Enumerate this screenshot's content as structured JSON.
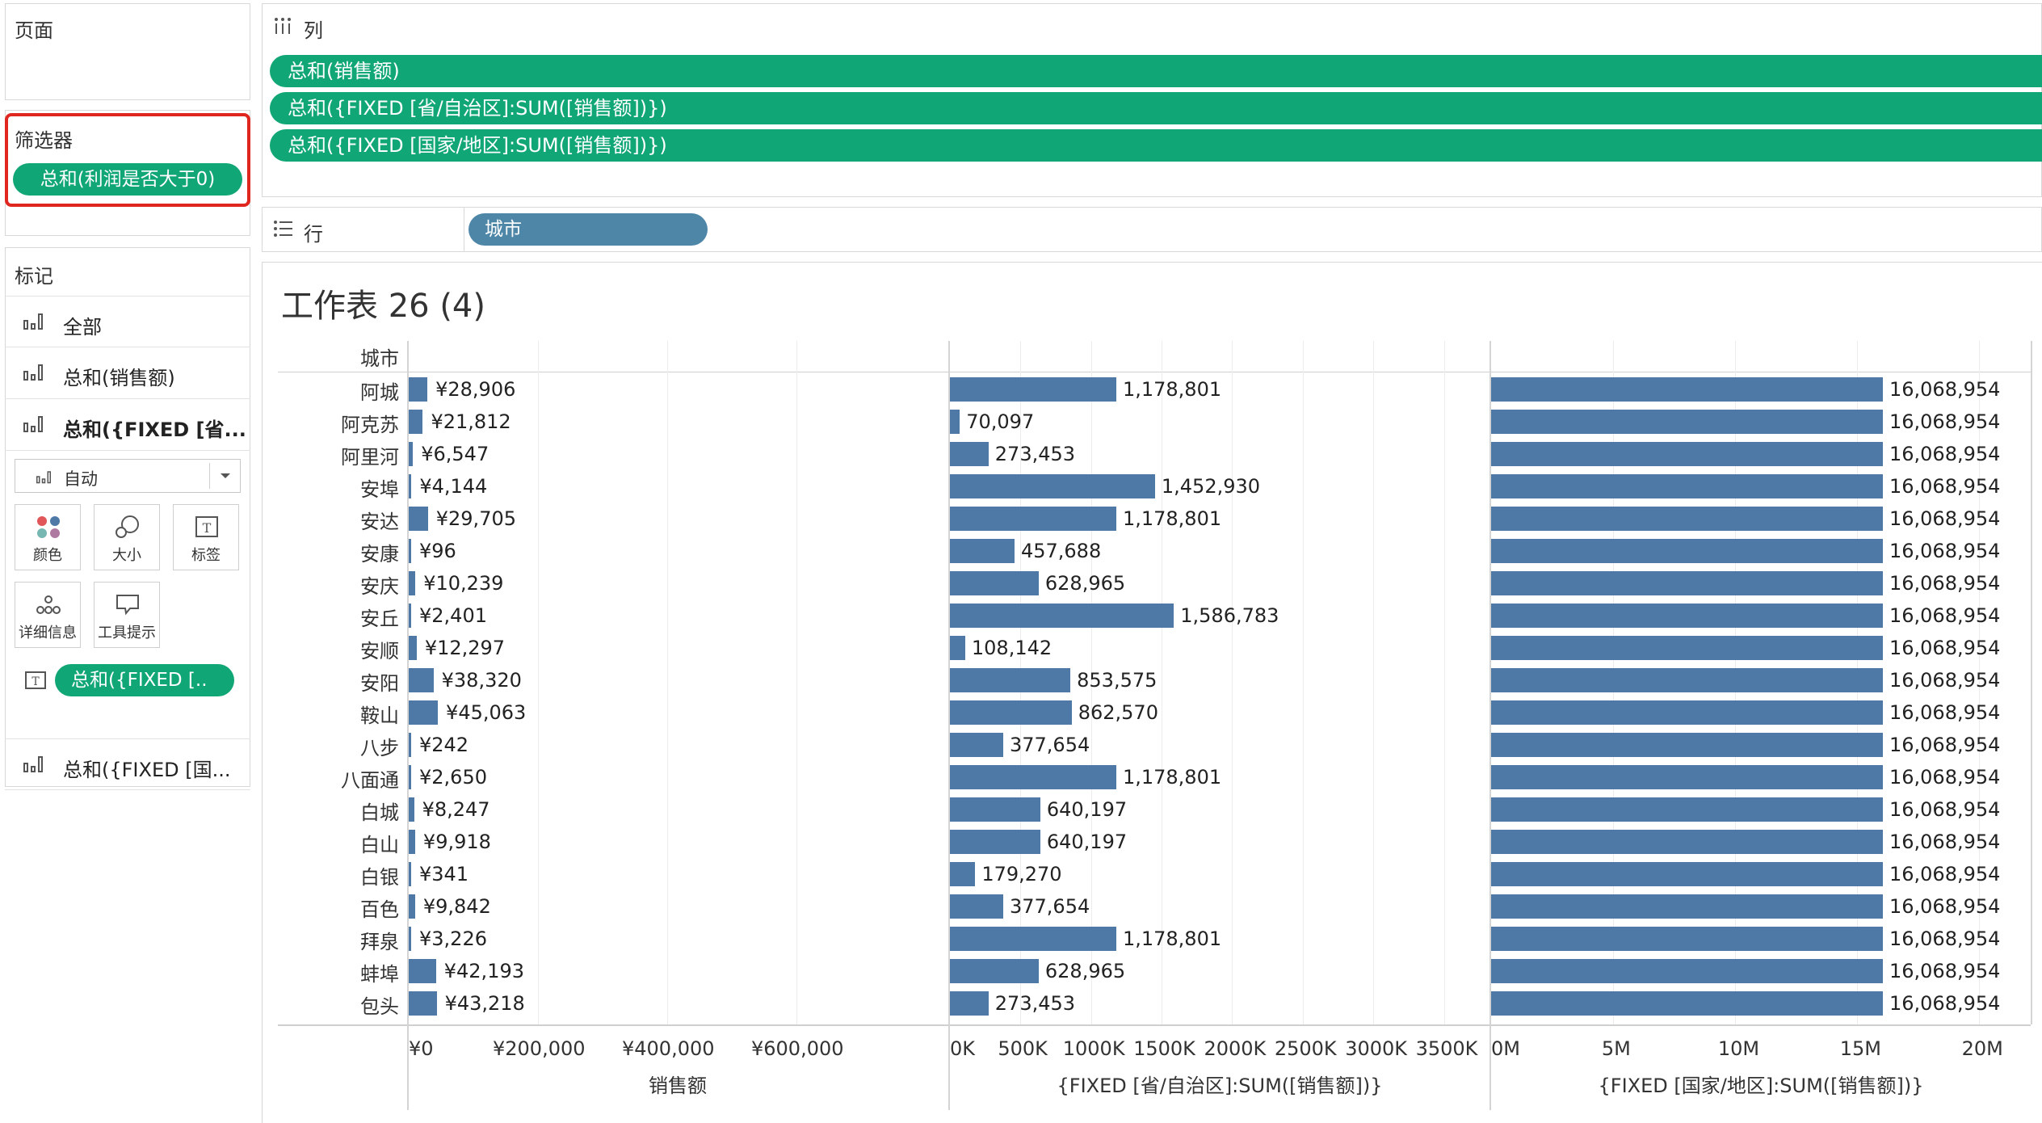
{
  "left_panel": {
    "pages_title": "页面",
    "filters_title": "筛选器",
    "filter_pill": "总和(利润是否大于0)",
    "marks_title": "标记",
    "mark_rows": [
      "全部",
      "总和(销售额)",
      "总和({FIXED [省...",
      "总和({FIXED [国..."
    ],
    "mark_type": "自动",
    "cards": [
      "颜色",
      "大小",
      "标签",
      "详细信息",
      "工具提示"
    ],
    "label_pill": "总和({FIXED [.."
  },
  "columns_shelf": {
    "label": "列",
    "pills": [
      "总和(销售额)",
      "总和({FIXED [省/自治区]:SUM([销售额])})",
      "总和({FIXED [国家/地区]:SUM([销售额])})"
    ]
  },
  "rows_shelf": {
    "label": "行",
    "pill": "城市"
  },
  "worksheet": {
    "title": "工作表 26 (4)",
    "row_header": "城市"
  },
  "colors": {
    "bar": "#4e79a7",
    "pill_green": "#11a675",
    "pill_blue": "#4e86a8",
    "highlight": "#e0271f"
  },
  "chart_data": {
    "type": "bar",
    "orientation": "horizontal",
    "categories": [
      "阿城",
      "阿克苏",
      "阿里河",
      "安埠",
      "安达",
      "安康",
      "安庆",
      "安丘",
      "安顺",
      "安阳",
      "鞍山",
      "八步",
      "八面通",
      "白城",
      "白山",
      "白银",
      "百色",
      "拜泉",
      "蚌埠",
      "包头"
    ],
    "series": [
      {
        "name": "销售额",
        "values": [
          28906,
          21812,
          6547,
          4144,
          29705,
          96,
          10239,
          2401,
          12297,
          38320,
          45063,
          242,
          2650,
          8247,
          9918,
          341,
          9842,
          3226,
          42193,
          43218
        ],
        "labels": [
          "¥28,906",
          "¥21,812",
          "¥6,547",
          "¥4,144",
          "¥29,705",
          "¥96",
          "¥10,239",
          "¥2,401",
          "¥12,297",
          "¥38,320",
          "¥45,063",
          "¥242",
          "¥2,650",
          "¥8,247",
          "¥9,918",
          "¥341",
          "¥9,842",
          "¥3,226",
          "¥42,193",
          "¥43,218"
        ],
        "ticks": [
          "¥0",
          "¥200,000",
          "¥400,000",
          "¥600,000"
        ],
        "xlim": [
          0,
          750000
        ]
      },
      {
        "name": "{FIXED [省/自治区]:SUM([销售额])}",
        "values": [
          1178801,
          70097,
          273453,
          1452930,
          1178801,
          457688,
          628965,
          1586783,
          108142,
          853575,
          862570,
          377654,
          1178801,
          640197,
          640197,
          179270,
          377654,
          1178801,
          628965,
          273453
        ],
        "labels": [
          "1,178,801",
          "70,097",
          "273,453",
          "1,452,930",
          "1,178,801",
          "457,688",
          "628,965",
          "1,586,783",
          "108,142",
          "853,575",
          "862,570",
          "377,654",
          "1,178,801",
          "640,197",
          "640,197",
          "179,270",
          "377,654",
          "1,178,801",
          "628,965",
          "273,453"
        ],
        "ticks": [
          "0K",
          "500K",
          "1000K",
          "1500K",
          "2000K",
          "2500K",
          "3000K",
          "3500K"
        ],
        "xlim": [
          0,
          3800000
        ]
      },
      {
        "name": "{FIXED [国家/地区]:SUM([销售额])}",
        "values": [
          16068954,
          16068954,
          16068954,
          16068954,
          16068954,
          16068954,
          16068954,
          16068954,
          16068954,
          16068954,
          16068954,
          16068954,
          16068954,
          16068954,
          16068954,
          16068954,
          16068954,
          16068954,
          16068954,
          16068954
        ],
        "labels": [
          "16,068,954",
          "16,068,954",
          "16,068,954",
          "16,068,954",
          "16,068,954",
          "16,068,954",
          "16,068,954",
          "16,068,954",
          "16,068,954",
          "16,068,954",
          "16,068,954",
          "16,068,954",
          "16,068,954",
          "16,068,954",
          "16,068,954",
          "16,068,954",
          "16,068,954",
          "16,068,954",
          "16,068,954",
          "16,068,954"
        ],
        "ticks": [
          "0M",
          "5M",
          "10M",
          "15M",
          "20M"
        ],
        "xlim": [
          0,
          22000000
        ]
      }
    ]
  }
}
